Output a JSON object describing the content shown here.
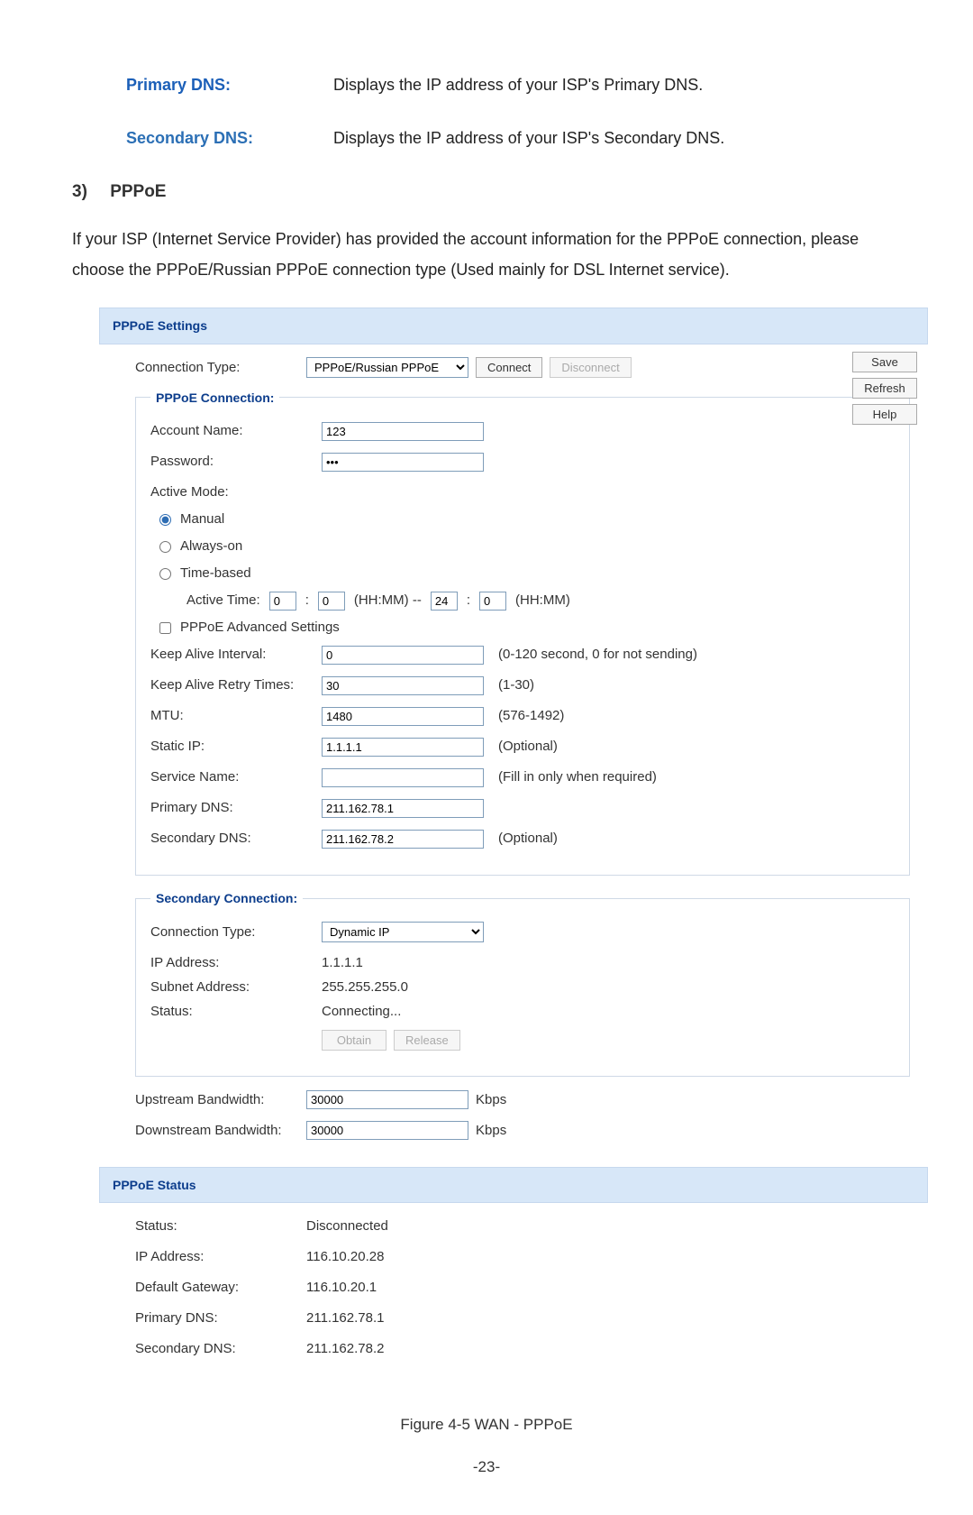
{
  "top": {
    "primary": {
      "label": "Primary DNS:",
      "desc": "Displays the IP address of your ISP's Primary DNS."
    },
    "secondary": {
      "label": "Secondary DNS:",
      "desc": "Displays the IP address of your ISP's Secondary DNS."
    }
  },
  "section": {
    "num": "3)",
    "title": "PPPoE"
  },
  "paragraph": "If your ISP (Internet Service Provider) has provided the account information for the PPPoE connection, please choose the PPPoE/Russian PPPoE connection type (Used mainly for DSL Internet service).",
  "settings": {
    "header": "PPPoE Settings",
    "conn_type_label": "Connection Type:",
    "conn_type_value": "PPPoE/Russian PPPoE",
    "connect": "Connect",
    "disconnect": "Disconnect",
    "save": "Save",
    "refresh": "Refresh",
    "help": "Help",
    "pppoe_legend": "PPPoE Connection:",
    "account_label": "Account Name:",
    "account_value": "123",
    "password_label": "Password:",
    "password_value": "•••",
    "active_mode_label": "Active Mode:",
    "mode_manual": "Manual",
    "mode_always": "Always-on",
    "mode_time": "Time-based",
    "active_time_label": "Active Time:",
    "t1h": "0",
    "t1m": "0",
    "t2h": "24",
    "t2m": "0",
    "hhmm1": "(HH:MM) --",
    "hhmm2": "(HH:MM)",
    "adv_settings": "PPPoE Advanced Settings",
    "keep_alive_label": "Keep Alive Interval:",
    "keep_alive_value": "0",
    "keep_alive_hint": "(0-120 second, 0 for not sending)",
    "retry_label": "Keep Alive Retry Times:",
    "retry_value": "30",
    "retry_hint": "(1-30)",
    "mtu_label": "MTU:",
    "mtu_value": "1480",
    "mtu_hint": "(576-1492)",
    "static_ip_label": "Static IP:",
    "static_ip_value": "1.1.1.1",
    "static_ip_hint": "(Optional)",
    "service_label": "Service Name:",
    "service_value": "",
    "service_hint": "(Fill in only when required)",
    "pri_dns_label": "Primary DNS:",
    "pri_dns_value": "211.162.78.1",
    "sec_dns_label": "Secondary DNS:",
    "sec_dns_value": "211.162.78.2",
    "sec_dns_hint": "(Optional)",
    "secondary_legend": "Secondary Connection:",
    "sec_conn_type_label": "Connection Type:",
    "sec_conn_type_value": "Dynamic IP",
    "sec_ip_label": "IP Address:",
    "sec_ip_value": "1.1.1.1",
    "sec_subnet_label": "Subnet Address:",
    "sec_subnet_value": "255.255.255.0",
    "sec_status_label": "Status:",
    "sec_status_value": "Connecting...",
    "obtain": "Obtain",
    "release": "Release",
    "up_label": "Upstream Bandwidth:",
    "up_value": "30000",
    "kbps": "Kbps",
    "down_label": "Downstream Bandwidth:",
    "down_value": "30000"
  },
  "status": {
    "header": "PPPoE Status",
    "status_label": "Status:",
    "status_value": "Disconnected",
    "ip_label": "IP Address:",
    "ip_value": "116.10.20.28",
    "gw_label": "Default Gateway:",
    "gw_value": "116.10.20.1",
    "pdns_label": "Primary DNS:",
    "pdns_value": "211.162.78.1",
    "sdns_label": "Secondary DNS:",
    "sdns_value": "211.162.78.2"
  },
  "figure_caption": "Figure 4-5 WAN - PPPoE",
  "page_number": "-23-"
}
